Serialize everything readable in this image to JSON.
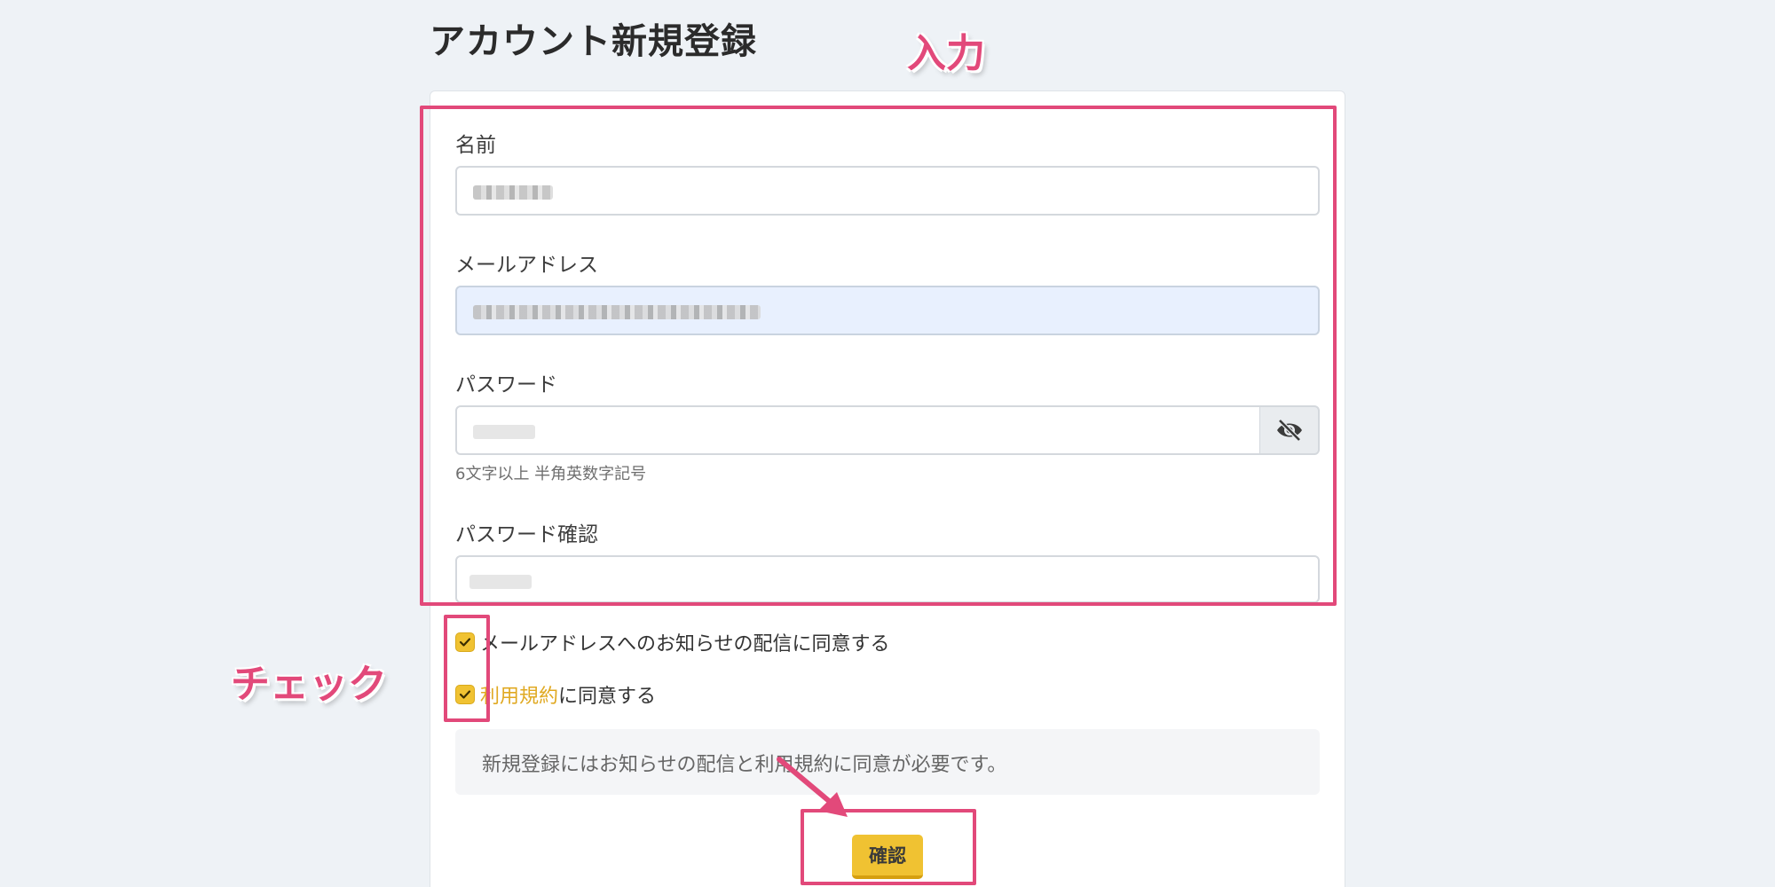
{
  "page": {
    "title": "アカウント新規登録"
  },
  "form": {
    "name_label": "名前",
    "email_label": "メールアドレス",
    "password_label": "パスワード",
    "password_hint": "6文字以上 半角英数字記号",
    "password_confirm_label": "パスワード確認",
    "checkbox_notifications_label": "メールアドレスへのお知らせの配信に同意する",
    "checkbox_terms_link": "利用規約",
    "checkbox_terms_suffix": "に同意する",
    "notice_text": "新規登録にはお知らせの配信と利用規約に同意が必要です。",
    "confirm_label": "確認",
    "checkbox_notifications_checked": true,
    "checkbox_terms_checked": true,
    "toggle_icon": "eye-slash-icon"
  },
  "annotations": {
    "input_label": "入力",
    "check_label": "チェック"
  },
  "colors": {
    "accent": "#f0c232",
    "annotation": "#e2497a",
    "autofill_bg": "#e8f0fe",
    "page_bg": "#eef2f6"
  }
}
